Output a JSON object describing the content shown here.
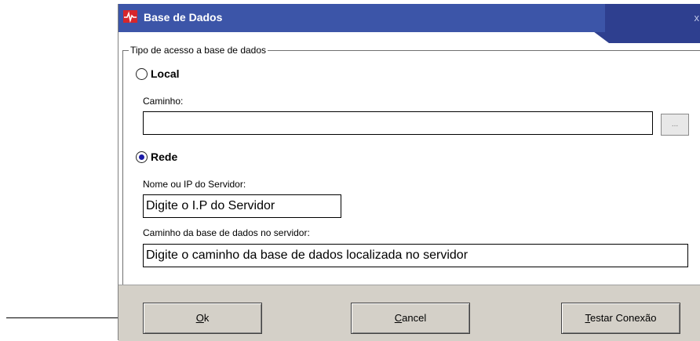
{
  "window": {
    "title": "Base de Dados",
    "close_label": "x"
  },
  "group": {
    "legend": "Tipo de acesso a base de dados"
  },
  "local": {
    "label": "Local",
    "checked": false,
    "path_label": "Caminho:",
    "path_value": "",
    "browse_label": "..."
  },
  "rede": {
    "label": "Rede",
    "checked": true,
    "server_label": "Nome ou IP do Servidor:",
    "server_value": "Digite o I.P do Servidor",
    "db_path_label": "Caminho da base de dados no servidor:",
    "db_path_value": "Digite o caminho da base de dados localizada no servidor"
  },
  "buttons": {
    "ok_mnemonic": "O",
    "ok_rest": "k",
    "cancel_mnemonic": "C",
    "cancel_rest": "ancel",
    "test_mnemonic": "T",
    "test_rest": "estar Conexão"
  },
  "colors": {
    "titlebar": "#2e3f8f",
    "dialog_bg": "#d4d0c8",
    "radio_dot": "#1a1aa6"
  },
  "icons": {
    "app": "heartbeat-icon",
    "annotation": "arrow-right-icon"
  }
}
